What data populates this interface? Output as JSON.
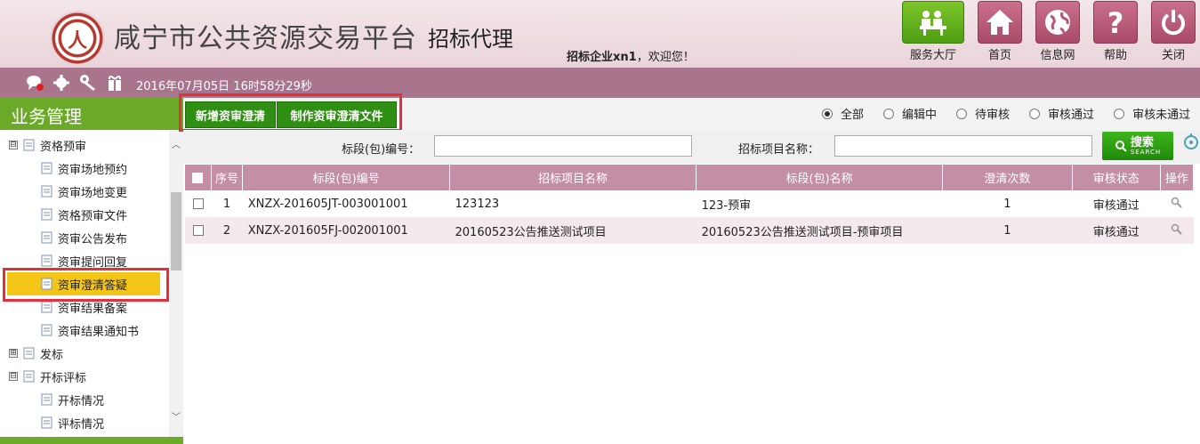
{
  "header": {
    "site_title": "咸宁市公共资源交易平台",
    "sub_title": "招标代理",
    "welcome_user": "招标企业xn1",
    "welcome_suffix": "，欢迎您！",
    "buttons": [
      {
        "label": "服务大厅",
        "icon": "service-hall-icon"
      },
      {
        "label": "首页",
        "icon": "home-icon"
      },
      {
        "label": "信息网",
        "icon": "globe-icon"
      },
      {
        "label": "帮助",
        "icon": "help-icon"
      },
      {
        "label": "关闭",
        "icon": "power-icon"
      }
    ]
  },
  "bar": {
    "datetime": "2016年07月05日 16时58分29秒",
    "icons": [
      "message-icon",
      "gear-icon",
      "key-icon",
      "gift-icon"
    ]
  },
  "sidebar": {
    "title": "业务管理",
    "items": [
      {
        "label": "资格预审",
        "type": "group",
        "state": "⊟"
      },
      {
        "label": "资审场地预约",
        "type": "leaf"
      },
      {
        "label": "资审场地变更",
        "type": "leaf"
      },
      {
        "label": "资格预审文件",
        "type": "leaf"
      },
      {
        "label": "资审公告发布",
        "type": "leaf"
      },
      {
        "label": "资审提问回复",
        "type": "leaf"
      },
      {
        "label": "资审澄清答疑",
        "type": "leaf",
        "selected": true
      },
      {
        "label": "资审结果备案",
        "type": "leaf"
      },
      {
        "label": "资审结果通知书",
        "type": "leaf"
      },
      {
        "label": "发标",
        "type": "group",
        "state": "⊞"
      },
      {
        "label": "开标评标",
        "type": "group",
        "state": "⊟"
      },
      {
        "label": "开标情况",
        "type": "leaf"
      },
      {
        "label": "评标情况",
        "type": "leaf"
      }
    ]
  },
  "toolbar": {
    "add_label": "新增资审澄清",
    "make_label": "制作资审澄清文件",
    "filters": [
      {
        "label": "全部",
        "checked": true
      },
      {
        "label": "编辑中",
        "checked": false
      },
      {
        "label": "待审核",
        "checked": false
      },
      {
        "label": "审核通过",
        "checked": false
      },
      {
        "label": "审核未通过",
        "checked": false
      }
    ]
  },
  "search": {
    "code_label": "标段(包)编号：",
    "code_value": "",
    "name_label": "招标项目名称：",
    "name_value": "",
    "button_label": "搜索",
    "button_sub": "SEARCH"
  },
  "table": {
    "headers": [
      "序号",
      "标段(包)编号",
      "招标项目名称",
      "标段(包)名称",
      "澄清次数",
      "审核状态",
      "操作"
    ],
    "rows": [
      {
        "no": "1",
        "code": "XNZX-201605JT-003001001",
        "project": "123123",
        "section": "123-预审",
        "count": "1",
        "status": "审核通过"
      },
      {
        "no": "2",
        "code": "XNZX-201605FJ-002001001",
        "project": "20160523公告推送测试项目",
        "section": "20160523公告推送测试项目-预审项目",
        "count": "1",
        "status": "审核通过"
      }
    ]
  },
  "colors": {
    "brand_purple": "#a9758d",
    "header_pink": "#e9d4da",
    "green": "#6aaa28",
    "button_green": "#2e8f12",
    "table_head": "#c48ea5",
    "selected": "#f2c516",
    "highlight_red": "#e5303b"
  }
}
